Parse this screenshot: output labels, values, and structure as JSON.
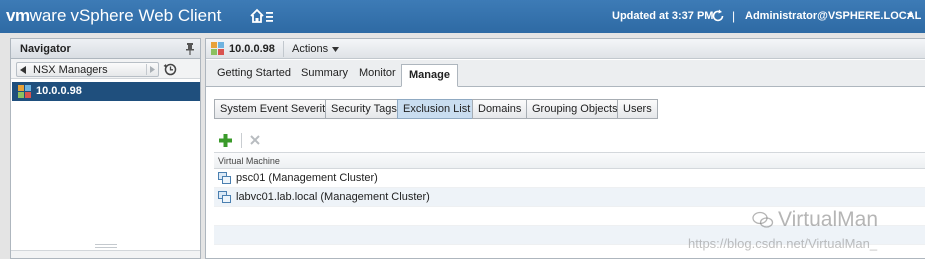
{
  "topbar": {
    "brand": "vm",
    "brand_suffix": "ware",
    "product": "vSphere Web Client",
    "updated": "Updated at 3:37 PM",
    "separator": "|",
    "user": "Administrator@VSPHERE.LOCAL"
  },
  "navigator": {
    "title": "Navigator",
    "breadcrumb": "NSX Managers",
    "items": [
      {
        "label": "10.0.0.98",
        "selected": true
      }
    ]
  },
  "object": {
    "title": "10.0.0.98",
    "actions_label": "Actions"
  },
  "tabs": [
    {
      "label": "Getting Started",
      "active": false
    },
    {
      "label": "Summary",
      "active": false
    },
    {
      "label": "Monitor",
      "active": false
    },
    {
      "label": "Manage",
      "active": true
    }
  ],
  "subtabs": [
    {
      "label": "System Event Severity",
      "active": false
    },
    {
      "label": "Security Tags",
      "active": false
    },
    {
      "label": "Exclusion List",
      "active": true
    },
    {
      "label": "Domains",
      "active": false
    },
    {
      "label": "Grouping Objects",
      "active": false
    },
    {
      "label": "Users",
      "active": false
    }
  ],
  "grid": {
    "column_header": "Virtual Machine",
    "rows": [
      {
        "label": "psc01 (Management Cluster)",
        "icon": "vm-icon"
      },
      {
        "label": "labvc01.lab.local (Management Cluster)",
        "icon": "vm-icon"
      }
    ]
  },
  "watermark": {
    "brand": "VirtualMan",
    "url": "https://blog.csdn.net/VirtualMan_"
  },
  "colors": {
    "topbar": "#2e6aa4",
    "selection": "#1f4f7d",
    "active_subtab": "#c9ddf0",
    "add_icon": "#3a9a2a"
  }
}
